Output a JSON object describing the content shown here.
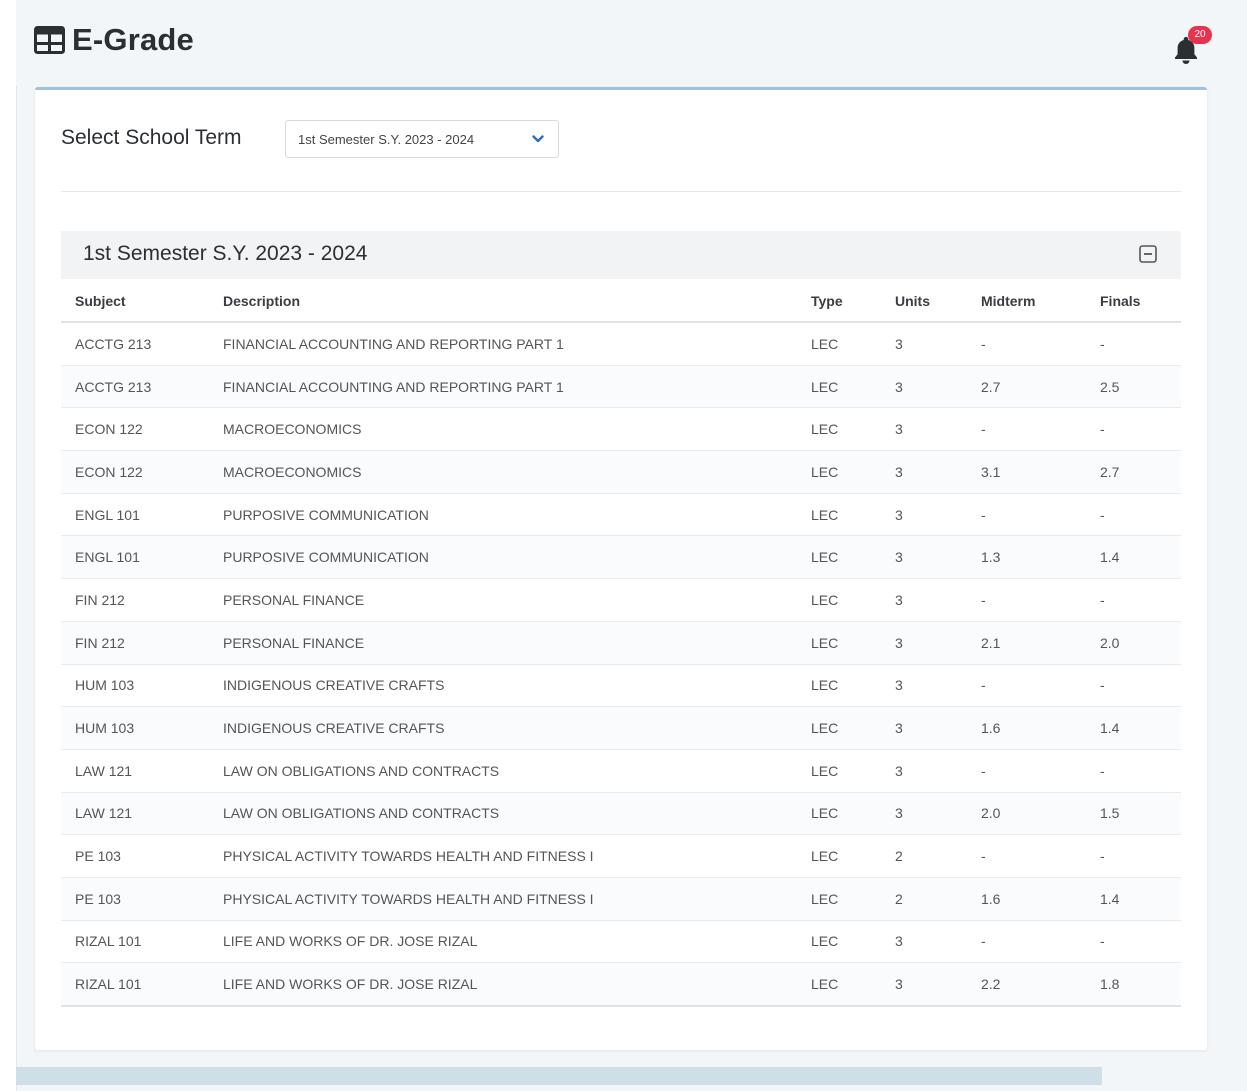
{
  "app": {
    "title": "E-Grade",
    "notification_count": "20"
  },
  "term": {
    "label": "Select School Term",
    "selected": "1st Semester S.Y. 2023 - 2024"
  },
  "semester": {
    "title": "1st Semester S.Y. 2023 - 2024"
  },
  "table": {
    "columns": [
      "Subject",
      "Description",
      "Type",
      "Units",
      "Midterm",
      "Finals"
    ],
    "rows": [
      [
        "ACCTG 213",
        "FINANCIAL ACCOUNTING AND REPORTING PART 1",
        "LEC",
        "3",
        "-",
        "-"
      ],
      [
        "ACCTG 213",
        "FINANCIAL ACCOUNTING AND REPORTING PART 1",
        "LEC",
        "3",
        "2.7",
        "2.5"
      ],
      [
        "ECON 122",
        "MACROECONOMICS",
        "LEC",
        "3",
        "-",
        "-"
      ],
      [
        "ECON 122",
        "MACROECONOMICS",
        "LEC",
        "3",
        "3.1",
        "2.7"
      ],
      [
        "ENGL 101",
        "PURPOSIVE COMMUNICATION",
        "LEC",
        "3",
        "-",
        "-"
      ],
      [
        "ENGL 101",
        "PURPOSIVE COMMUNICATION",
        "LEC",
        "3",
        "1.3",
        "1.4"
      ],
      [
        "FIN 212",
        "PERSONAL FINANCE",
        "LEC",
        "3",
        "-",
        "-"
      ],
      [
        "FIN 212",
        "PERSONAL FINANCE",
        "LEC",
        "3",
        "2.1",
        "2.0"
      ],
      [
        "HUM 103",
        "INDIGENOUS CREATIVE CRAFTS",
        "LEC",
        "3",
        "-",
        "-"
      ],
      [
        "HUM 103",
        "INDIGENOUS CREATIVE CRAFTS",
        "LEC",
        "3",
        "1.6",
        "1.4"
      ],
      [
        "LAW 121",
        "LAW ON OBLIGATIONS AND CONTRACTS",
        "LEC",
        "3",
        "-",
        "-"
      ],
      [
        "LAW 121",
        "LAW ON OBLIGATIONS AND CONTRACTS",
        "LEC",
        "3",
        "2.0",
        "1.5"
      ],
      [
        "PE 103",
        "PHYSICAL ACTIVITY TOWARDS HEALTH AND FITNESS I",
        "LEC",
        "2",
        "-",
        "-"
      ],
      [
        "PE 103",
        "PHYSICAL ACTIVITY TOWARDS HEALTH AND FITNESS I",
        "LEC",
        "2",
        "1.6",
        "1.4"
      ],
      [
        "RIZAL 101",
        "LIFE AND WORKS OF DR. JOSE RIZAL",
        "LEC",
        "3",
        "-",
        "-"
      ],
      [
        "RIZAL 101",
        "LIFE AND WORKS OF DR. JOSE RIZAL",
        "LEC",
        "3",
        "2.2",
        "1.8"
      ]
    ]
  },
  "icons": {
    "app": "table-grid-icon",
    "notifications": "bell-icon",
    "dropdown": "chevron-down-icon",
    "collapse": "collapse-minus-icon"
  },
  "colors": {
    "accent_border": "#9fc3dc",
    "badge": "#e8334f",
    "chevron": "#2a6ebb"
  }
}
